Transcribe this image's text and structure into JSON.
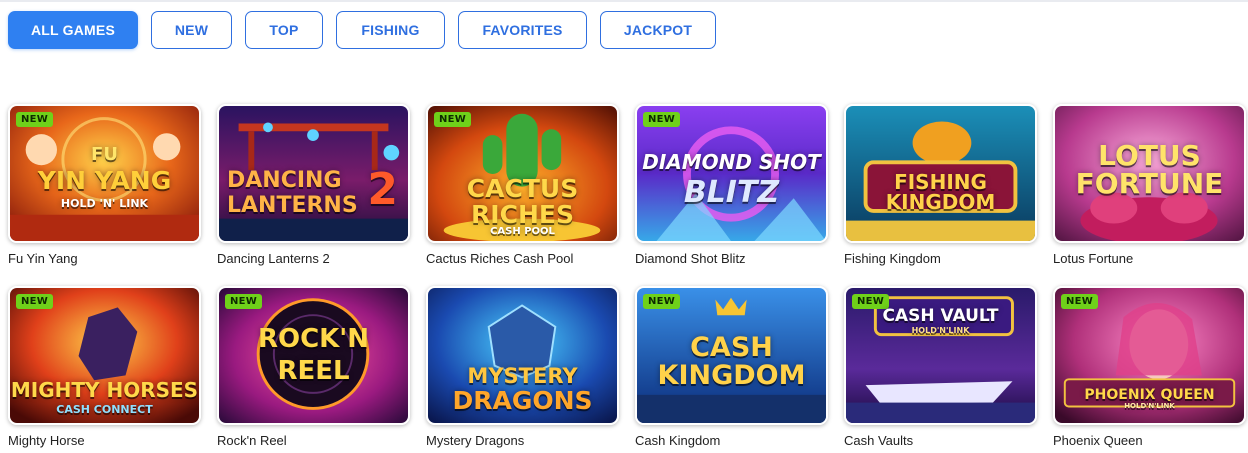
{
  "filters": [
    {
      "label": "ALL GAMES",
      "active": true
    },
    {
      "label": "NEW",
      "active": false
    },
    {
      "label": "TOP",
      "active": false
    },
    {
      "label": "FISHING",
      "active": false
    },
    {
      "label": "FAVORITES",
      "active": false
    },
    {
      "label": "JACKPOT",
      "active": false
    }
  ],
  "badge_text": "NEW",
  "games": [
    {
      "name": "Fu Yin Yang",
      "is_new": true,
      "art_lines": [
        "FU",
        "YIN YANG",
        "HOLD 'N' LINK"
      ]
    },
    {
      "name": "Dancing Lanterns 2",
      "is_new": false,
      "art_lines": [
        "DANCING",
        "LANTERNS",
        "2"
      ]
    },
    {
      "name": "Cactus Riches Cash Pool",
      "is_new": true,
      "art_lines": [
        "CACTUS",
        "RICHES",
        "CASH POOL"
      ]
    },
    {
      "name": "Diamond Shot Blitz",
      "is_new": true,
      "art_lines": [
        "DIAMOND SHOT",
        "BLITZ"
      ]
    },
    {
      "name": "Fishing Kingdom",
      "is_new": false,
      "art_lines": [
        "FISHING",
        "KINGDOM"
      ]
    },
    {
      "name": "Lotus Fortune",
      "is_new": false,
      "art_lines": [
        "LOTUS",
        "FORTUNE"
      ]
    },
    {
      "name": "Mighty Horse",
      "is_new": true,
      "art_lines": [
        "MIGHTY HORSES",
        "CASH CONNECT"
      ]
    },
    {
      "name": "Rock'n Reel",
      "is_new": true,
      "art_lines": [
        "ROCK'N",
        "REEL"
      ]
    },
    {
      "name": "Mystery Dragons",
      "is_new": false,
      "art_lines": [
        "MYSTERY",
        "DRAGONS"
      ]
    },
    {
      "name": "Cash Kingdom",
      "is_new": true,
      "art_lines": [
        "CASH",
        "KINGDOM"
      ]
    },
    {
      "name": "Cash Vaults",
      "is_new": true,
      "art_lines": [
        "CASH VAULT",
        "HOLD'N'LINK"
      ]
    },
    {
      "name": "Phoenix Queen",
      "is_new": true,
      "art_lines": [
        "PHOENIX QUEEN",
        "HOLD'N'LINK"
      ]
    }
  ]
}
